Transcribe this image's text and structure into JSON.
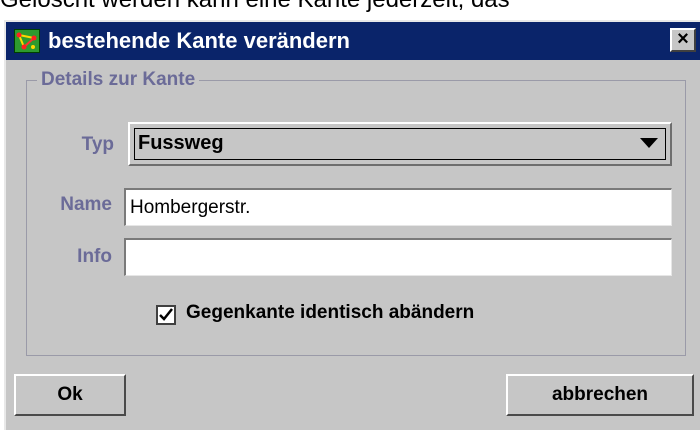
{
  "background_text": "Gelöscht werden kann eine Kante jederzeit, das",
  "window": {
    "title": "bestehende Kante verändern",
    "close_label": "×",
    "titlebar_color": "#0a246a"
  },
  "group": {
    "legend": "Details zur Kante"
  },
  "fields": {
    "typ_label": "Typ",
    "typ_value": "Fussweg",
    "name_label": "Name",
    "name_value": "Hombergerstr.",
    "info_label": "Info",
    "info_value": ""
  },
  "checkbox": {
    "label": "Gegenkante identisch abändern",
    "checked": true
  },
  "buttons": {
    "ok_label": "Ok",
    "cancel_label": "abbrechen"
  },
  "icons": {
    "app_icon": "graph-icon",
    "select_arrow": "chevron-down-icon",
    "check": "checkmark-icon"
  }
}
